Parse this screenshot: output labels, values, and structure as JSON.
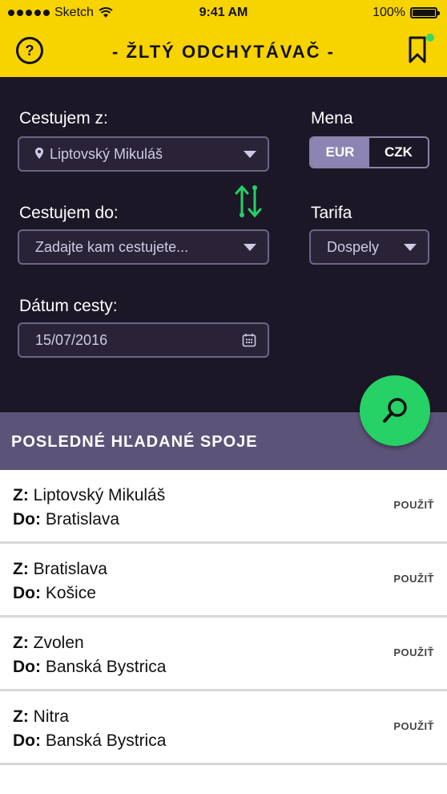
{
  "status": {
    "carrier": "Sketch",
    "time": "9:41 AM",
    "battery": "100%"
  },
  "header": {
    "title": "- ŽLTÝ ODCHYTÁVAČ -",
    "help_icon": "?"
  },
  "form": {
    "from_label": "Cestujem z:",
    "from_value": "Liptovský Mikuláš",
    "to_label": "Cestujem do:",
    "to_placeholder": "Zadajte  kam cestujete...",
    "date_label": "Dátum cesty:",
    "date_value": "15/07/2016",
    "currency_label": "Mena",
    "currency_options": [
      "EUR",
      "CZK"
    ],
    "currency_selected": "EUR",
    "tariff_label": "Tarifa",
    "tariff_value": "Dospely"
  },
  "recent": {
    "title": "POSLEDNÉ HĽADANÉ SPOJE",
    "from_prefix": "Z:",
    "to_prefix": "Do:",
    "use_label": "POUŽIŤ",
    "items": [
      {
        "from": "Liptovský Mikuláš",
        "to": "Bratislava"
      },
      {
        "from": "Bratislava",
        "to": "Košice"
      },
      {
        "from": "Zvolen",
        "to": "Banská Bystrica"
      },
      {
        "from": "Nitra",
        "to": "Banská Bystrica"
      }
    ]
  },
  "colors": {
    "accent_yellow": "#f7d300",
    "dark_panel": "#1c1727",
    "section_bar": "#5c5478",
    "green": "#26d166"
  }
}
